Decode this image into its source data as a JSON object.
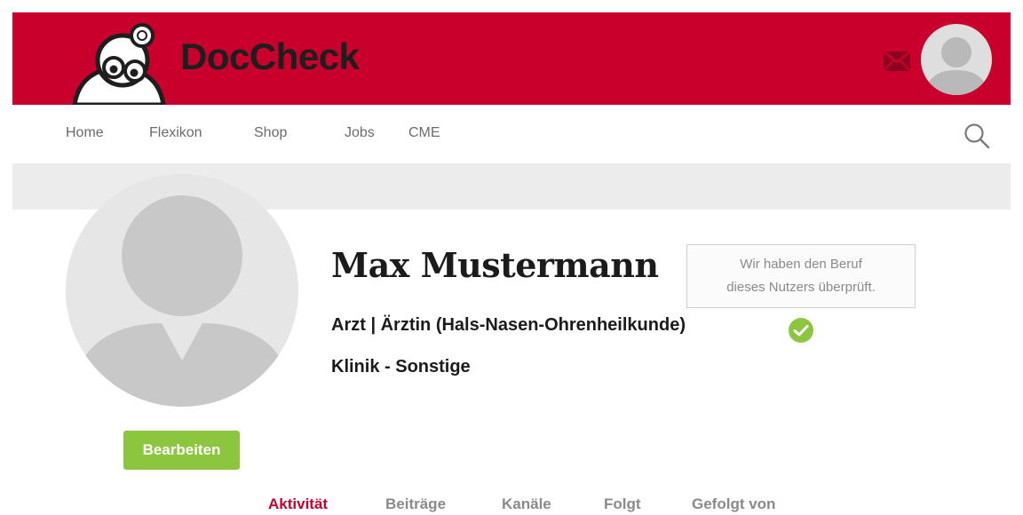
{
  "header": {
    "logo_text": "DocCheck",
    "brand_color": "#c8002b",
    "mail_icon": "envelope-icon",
    "avatar_icon": "user-avatar-icon"
  },
  "nav": {
    "items": [
      {
        "label": "Home"
      },
      {
        "label": "Flexikon"
      },
      {
        "label": "Shop"
      },
      {
        "label": "Jobs"
      },
      {
        "label": "CME"
      }
    ],
    "search_icon": "search-icon"
  },
  "profile": {
    "name": "Max Mustermann",
    "verification_tooltip": {
      "line1": "Wir haben den Beruf",
      "line2": "dieses Nutzers überprüft."
    },
    "profession": "Arzt | Ärztin (Hals-Nasen-Ohrenheilkunde)",
    "verified_color": "#8cc63f",
    "workplace": "Klinik - Sonstige",
    "edit_label": "Bearbeiten"
  },
  "tabs": [
    {
      "label": "Aktivität",
      "active": true
    },
    {
      "label": "Beiträge",
      "active": false
    },
    {
      "label": "Kanäle",
      "active": false
    },
    {
      "label": "Folgt",
      "active": false
    },
    {
      "label": "Gefolgt von",
      "active": false
    }
  ]
}
